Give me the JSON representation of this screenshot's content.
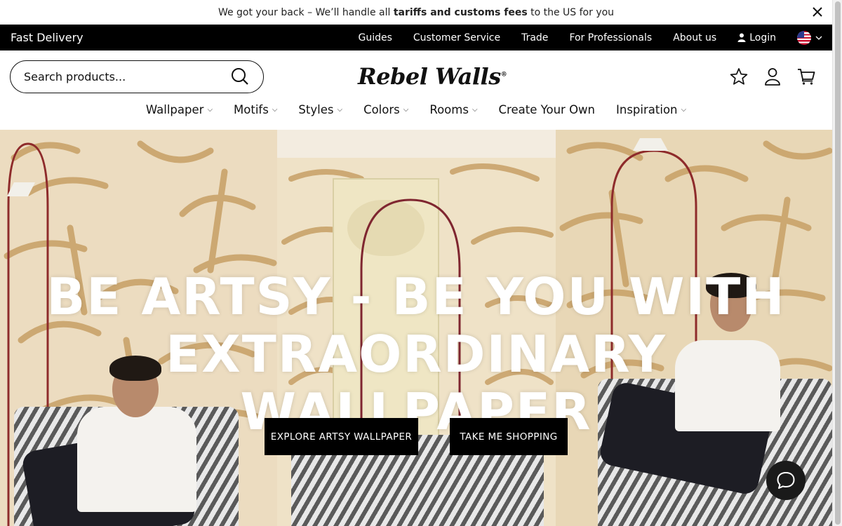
{
  "announcement": {
    "prefix": "We got your back – We’ll handle all ",
    "bold": "tariffs and customs fees",
    "suffix": " to the US for you"
  },
  "utility": {
    "fast_delivery": "Fast Delivery",
    "links": [
      "Guides",
      "Customer Service",
      "Trade",
      "For Professionals",
      "About us"
    ],
    "login": "Login",
    "flag_icon": "us-flag-icon"
  },
  "header": {
    "search_placeholder": "Search products...",
    "logo": "Rebel Walls",
    "logo_mark": "®"
  },
  "nav": {
    "items": [
      {
        "label": "Wallpaper",
        "dropdown": true
      },
      {
        "label": "Motifs",
        "dropdown": true
      },
      {
        "label": "Styles",
        "dropdown": true
      },
      {
        "label": "Colors",
        "dropdown": true
      },
      {
        "label": "Rooms",
        "dropdown": true
      },
      {
        "label": "Create Your Own",
        "dropdown": false
      },
      {
        "label": "Inspiration",
        "dropdown": true
      }
    ]
  },
  "hero": {
    "headline_1": "BE ARTSY - BE YOU WITH",
    "headline_2": "EXTRAORDINARY WALLPAPER",
    "cta_primary": "EXPLORE ARTSY WALLPAPER",
    "cta_secondary": "TAKE ME SHOPPING",
    "pattern_color": "#c9a36a"
  },
  "icons": [
    "close-icon",
    "user-icon",
    "chevron-down-icon",
    "search-icon",
    "star-icon",
    "account-icon",
    "cart-icon",
    "chat-icon"
  ]
}
